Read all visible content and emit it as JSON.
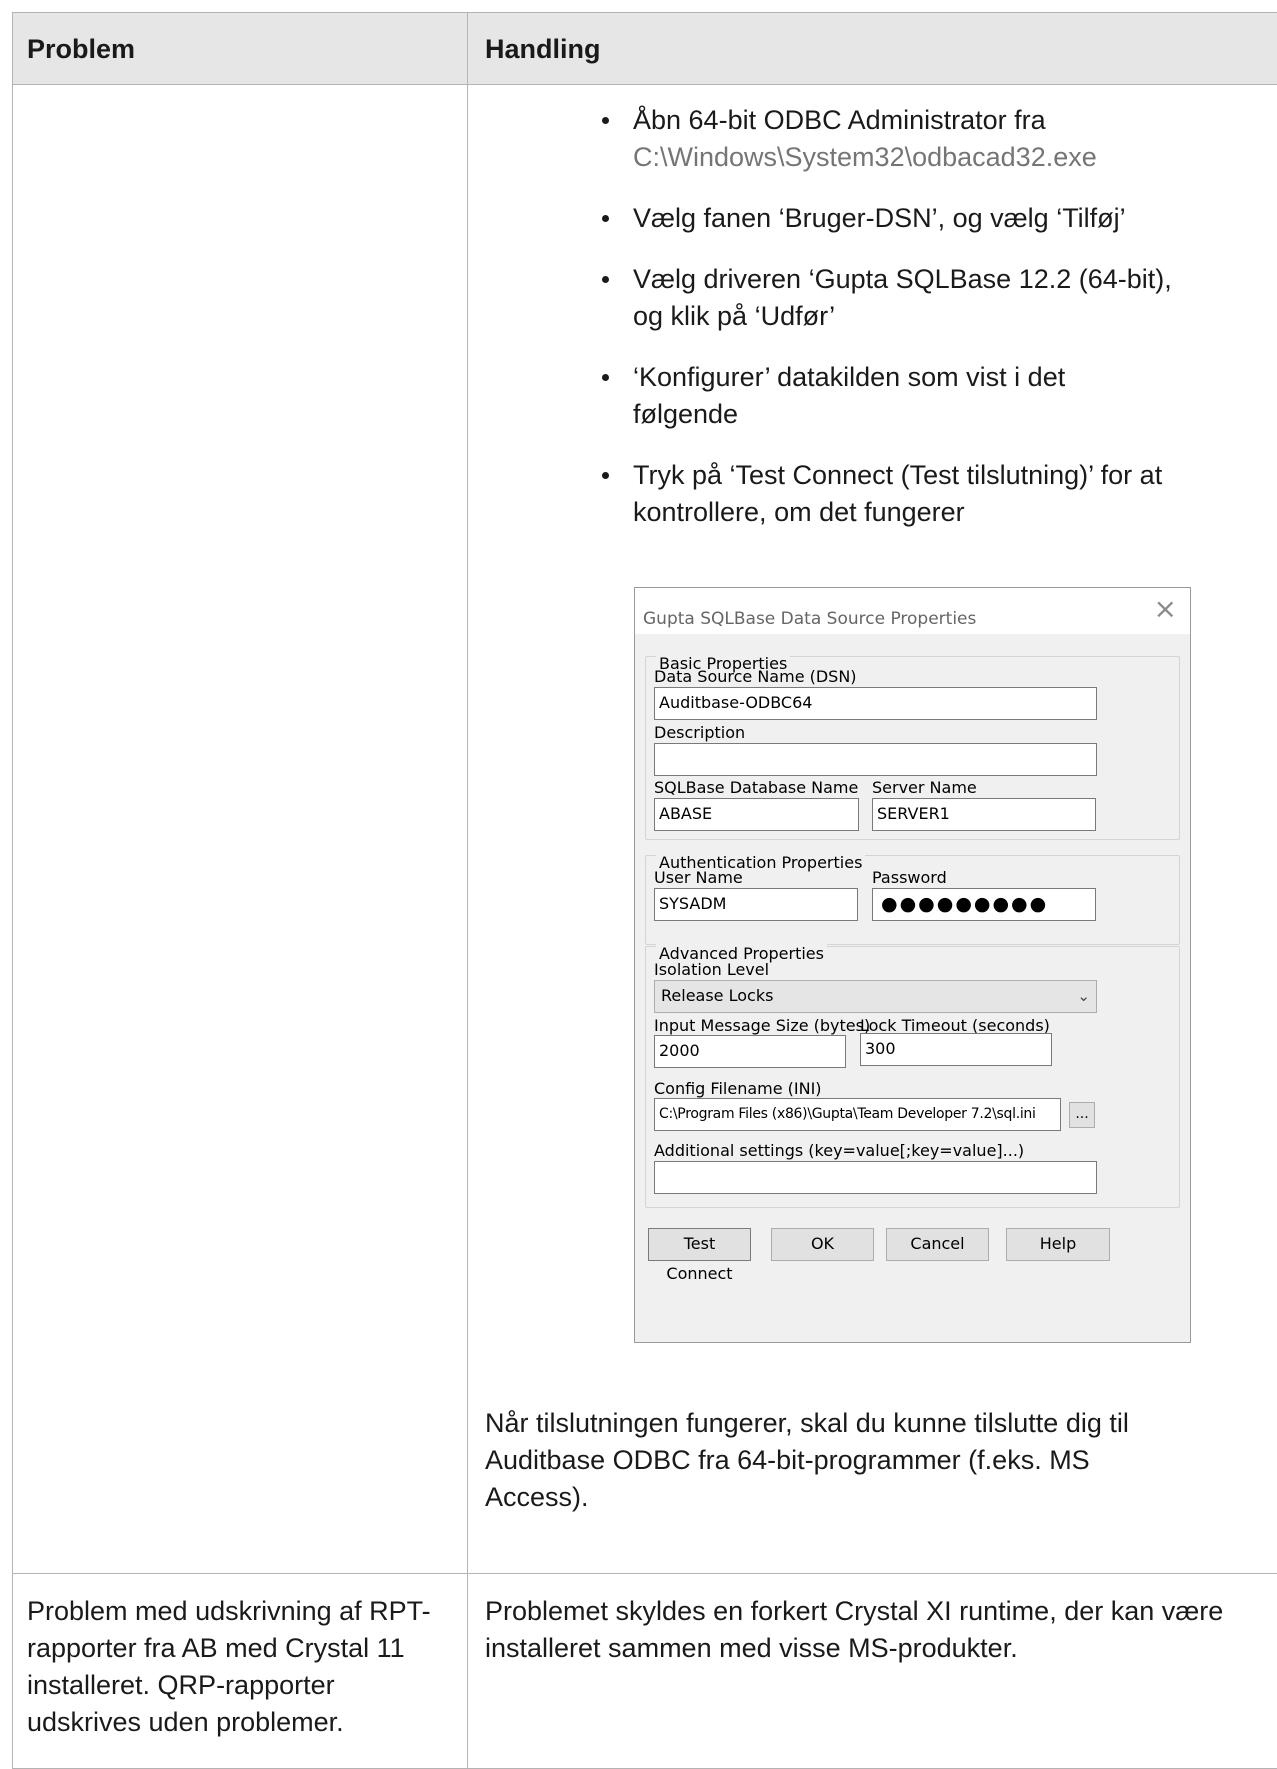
{
  "table": {
    "headers": {
      "problem": "Problem",
      "action": "Handling"
    },
    "row1": {
      "bullets": [
        {
          "text": "Åbn 64-bit ODBC Administrator fra",
          "path": "C:\\Windows\\System32\\odbacad32.exe"
        },
        {
          "text": "Vælg fanen ‘Bruger-DSN’, og vælg ‘Tilføj’"
        },
        {
          "text": "Vælg driveren ‘Gupta SQLBase 12.2 (64-bit), og klik på ‘Udfør’"
        },
        {
          "text": "‘Konfigurer’ datakilden som vist i det følgende"
        },
        {
          "text": "Tryk på ‘Test Connect (Test tilslutning)’ for at kontrollere, om det fungerer"
        }
      ],
      "conclusion": "Når tilslutningen fungerer, skal du kunne tilslutte dig til Auditbase ODBC fra 64-bit-programmer (f.eks. MS Access)."
    },
    "row2": {
      "problem": "Problem med udskrivning af RPT-rapporter fra AB med Crystal 11 installeret. QRP-rapporter udskrives uden problemer.",
      "action": "Problemet skyldes en forkert Crystal XI runtime, der kan være installeret sammen med visse MS-produkter."
    }
  },
  "dialog": {
    "title": "Gupta SQLBase Data Source Properties",
    "basic": {
      "legend": "Basic Properties",
      "dsn_label": "Data Source Name (DSN)",
      "dsn_value": "Auditbase-ODBC64",
      "description_label": "Description",
      "description_value": "",
      "dbname_label": "SQLBase Database Name",
      "dbname_value": "ABASE",
      "server_label": "Server Name",
      "server_value": "SERVER1"
    },
    "auth": {
      "legend": "Authentication Properties",
      "user_label": "User Name",
      "user_value": "SYSADM",
      "password_label": "Password",
      "password_mask": "●●●●●●●●●"
    },
    "advanced": {
      "legend": "Advanced Properties",
      "isolation_label": "Isolation Level",
      "isolation_value": "Release Locks",
      "msgsize_label": "Input Message Size (bytes)",
      "msgsize_value": "2000",
      "timeout_label": "Lock Timeout (seconds)",
      "timeout_value": "300",
      "config_label": "Config Filename (INI)",
      "config_value": "C:\\Program Files (x86)\\Gupta\\Team Developer 7.2\\sql.ini",
      "browse_label": "...",
      "additional_label": "Additional settings (key=value[;key=value]...)",
      "additional_value": ""
    },
    "buttons": {
      "test": "Test Connect",
      "ok": "OK",
      "cancel": "Cancel",
      "help": "Help"
    },
    "icons": {
      "close": "close-icon",
      "dropdown": "chevron-down-icon"
    }
  }
}
